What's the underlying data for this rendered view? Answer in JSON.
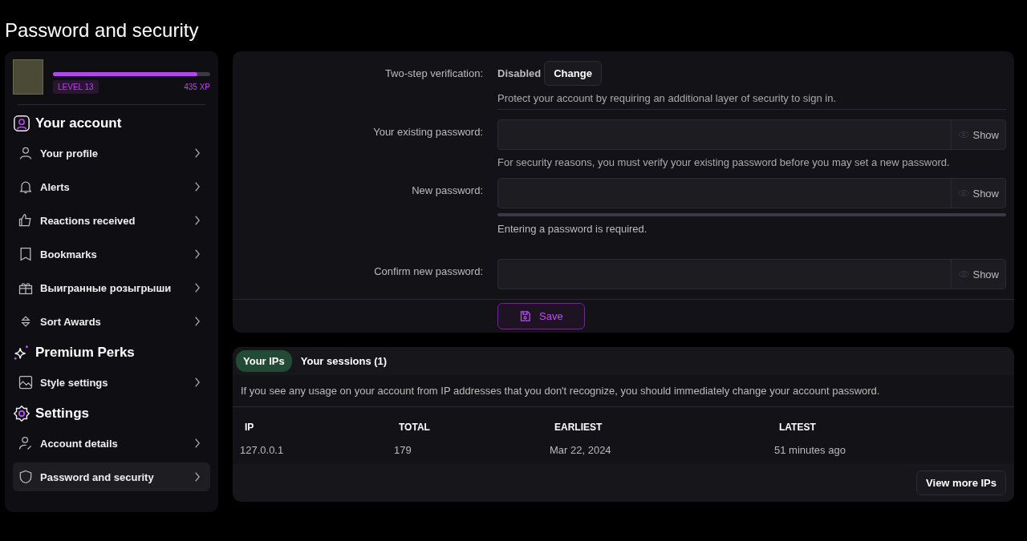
{
  "page_title": "Password and security",
  "profile": {
    "level_label": "LEVEL 13",
    "xp": "435 XP",
    "level": 0.92
  },
  "sidebar": [
    {
      "heading": "Your account",
      "items": [
        {
          "label": "Your profile",
          "selected": false
        },
        {
          "label": "Alerts",
          "selected": false
        },
        {
          "label": "Reactions received",
          "selected": false
        },
        {
          "label": "Bookmarks",
          "selected": false
        },
        {
          "label": "Выигранные розыгрыши",
          "selected": false
        },
        {
          "label": "Sort Awards",
          "selected": false
        }
      ]
    },
    {
      "heading": "Premium Perks",
      "items": [
        {
          "label": "Style settings",
          "selected": false
        }
      ]
    },
    {
      "heading": "Settings",
      "items": [
        {
          "label": "Account details",
          "selected": false
        },
        {
          "label": "Password and security",
          "selected": true
        }
      ]
    }
  ],
  "form": {
    "rows": [
      {
        "kind": "status",
        "label": "Two-step verification:",
        "status": "Disabled",
        "button": "Change",
        "hint": "Protect your account by requiring an additional layer of security to sign in."
      },
      {
        "kind": "password",
        "label": "Your existing password:",
        "show": "Show",
        "hint": "For security reasons, you must verify your existing password before you may set a new password."
      },
      {
        "kind": "password",
        "label": "New password:",
        "show": "Show",
        "strength_meter": true,
        "hint": "Entering a password is required."
      },
      {
        "kind": "password",
        "label": "Confirm new password:",
        "show": "Show"
      }
    ],
    "save": "Save"
  },
  "ips": {
    "tabs": [
      {
        "label": "Your IPs",
        "selected": true
      },
      {
        "label": "Your sessions (1)",
        "selected": false
      }
    ],
    "notice": "If you see any usage on your account from IP addresses that you don't recognize, you should immediately change your account password.",
    "columns": [
      "IP",
      "TOTAL",
      "EARLIEST",
      "LATEST"
    ],
    "rows": [
      [
        "127.0.0.1",
        "179",
        "Mar 22, 2024",
        "51 minutes ago"
      ]
    ],
    "more": "View more IPs"
  }
}
